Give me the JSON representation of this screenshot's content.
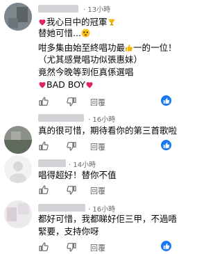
{
  "comments": [
    {
      "time": "13小時",
      "lines": [
        "我心目中的冠軍",
        "替她可惜...",
        "咁多集由始至終唱功最",
        "一的一位！",
        "（尤其感覺唱功似張惠妹）",
        "竟然今晚等到佢真係選唱",
        "BAD BOY"
      ],
      "reply_label": "回覆"
    },
    {
      "time": "16小時",
      "lines": [
        "真的很可惜，期待看你的第三首歌啦"
      ],
      "reply_label": "回覆"
    },
    {
      "time": "14小時",
      "lines": [
        "唱得超好！替你不值"
      ],
      "reply_label": "回覆"
    },
    {
      "time": "16小時",
      "lines": [
        "都好可惜，我都睇好佢三甲，不過唔",
        "緊要，支持你呀"
      ],
      "reply_label": "回覆"
    }
  ],
  "colors": {
    "like_blue": "#1877f2",
    "meta_gray": "#65676b",
    "heart_red": "#e0245e"
  },
  "icons": [
    "heart-icon",
    "trophy-icon",
    "teary-face-icon",
    "thumbs-up-icon",
    "dislike-icon",
    "like-reaction-icon"
  ]
}
